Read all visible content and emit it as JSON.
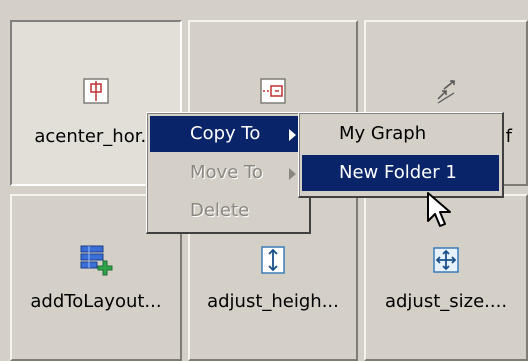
{
  "tiles": [
    {
      "label": "acenter_hor...",
      "icon": "align-center-horizontal-icon",
      "selected": true
    },
    {
      "label": "",
      "icon": "align-connector-icon",
      "selected": false
    },
    {
      "label": "f",
      "icon": "reverse-edge-icon",
      "selected": false
    },
    {
      "label": "addToLayout...",
      "icon": "add-to-layout-icon",
      "selected": false
    },
    {
      "label": "adjust_heigh...",
      "icon": "adjust-height-icon",
      "selected": false
    },
    {
      "label": "adjust_size....",
      "icon": "adjust-size-icon",
      "selected": false
    }
  ],
  "context_menu": {
    "items": [
      {
        "label": "Copy To",
        "state": "highlighted",
        "submenu": true
      },
      {
        "label": "Move To",
        "state": "disabled",
        "submenu": true
      },
      {
        "label": "Delete",
        "state": "disabled",
        "submenu": false
      }
    ]
  },
  "submenu": {
    "items": [
      {
        "label": "My Graph",
        "state": "normal"
      },
      {
        "label": "New Folder 1",
        "state": "highlighted"
      }
    ]
  },
  "colors": {
    "face": "#d4d0c8",
    "highlight": "#0a246a",
    "disabled_text": "#8a8780"
  }
}
